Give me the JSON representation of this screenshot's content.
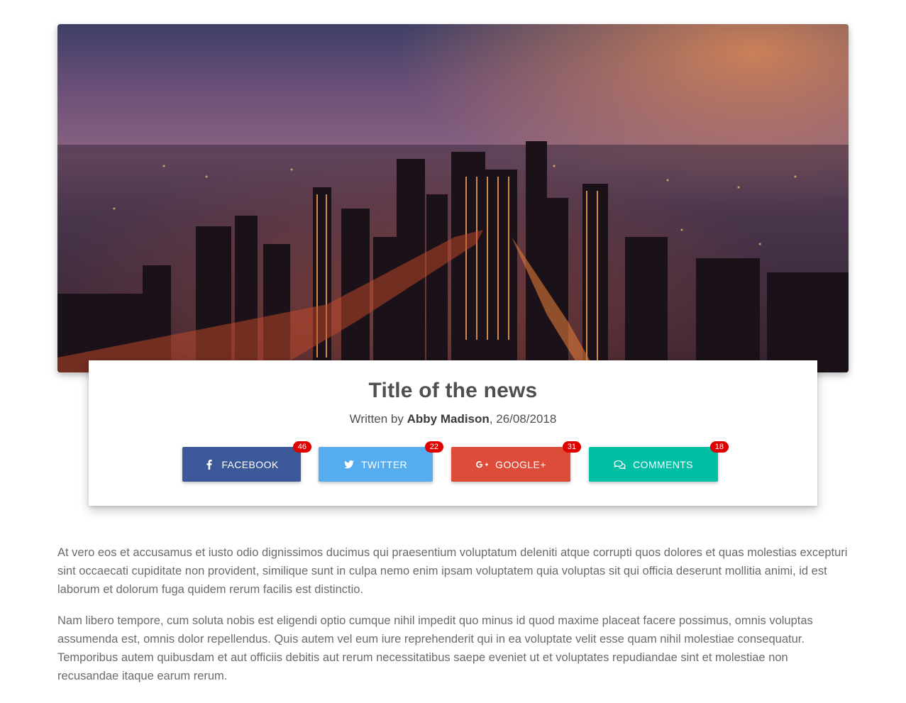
{
  "hero": {
    "image_subject": "city skyline at dusk",
    "sky_top": "#5b4a7a",
    "glow": "#e07a4a"
  },
  "article": {
    "title": "Title of the news",
    "byline_prefix": "Written by ",
    "author": "Abby Madison",
    "date_sep": ", ",
    "date": "26/08/2018"
  },
  "share": [
    {
      "label": "FACEBOOK",
      "count": "46",
      "icon": "facebook-icon",
      "color": "#3b5998"
    },
    {
      "label": "TWITTER",
      "count": "22",
      "icon": "twitter-icon",
      "color": "#55acee"
    },
    {
      "label": "GOOGLE+",
      "count": "31",
      "icon": "google-plus-icon",
      "color": "#dd4b39"
    },
    {
      "label": "COMMENTS",
      "count": "18",
      "icon": "comments-icon",
      "color": "#00bfa5"
    }
  ],
  "badge_color": "#e00000",
  "body": {
    "p1": "At vero eos et accusamus et iusto odio dignissimos ducimus qui praesentium voluptatum deleniti atque corrupti quos dolores et quas molestias excepturi sint occaecati cupiditate non provident, similique sunt in culpa nemo enim ipsam voluptatem quia voluptas sit qui officia deserunt mollitia animi, id est laborum et dolorum fuga quidem rerum facilis est distinctio.",
    "p2": "Nam libero tempore, cum soluta nobis est eligendi optio cumque nihil impedit quo minus id quod maxime placeat facere possimus, omnis voluptas assumenda est, omnis dolor repellendus. Quis autem vel eum iure reprehenderit qui in ea voluptate velit esse quam nihil molestiae consequatur. Temporibus autem quibusdam et aut officiis debitis aut rerum necessitatibus saepe eveniet ut et voluptates repudiandae sint et molestiae non recusandae itaque earum rerum."
  }
}
